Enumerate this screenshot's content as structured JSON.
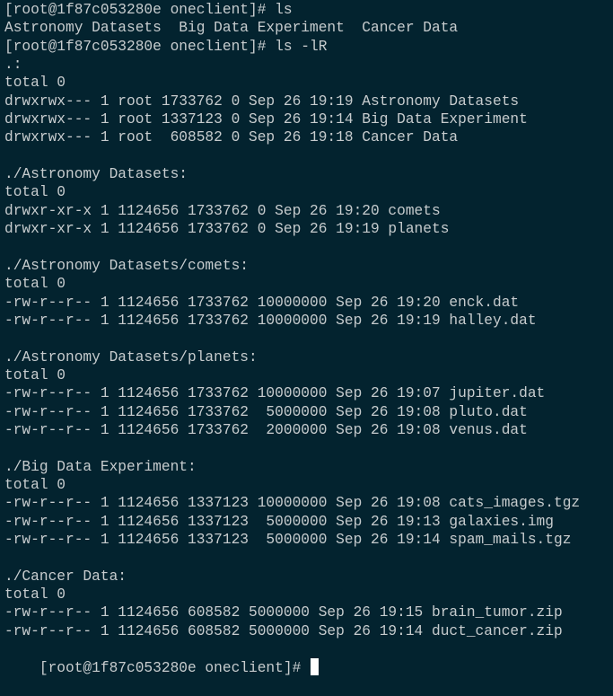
{
  "terminal": {
    "prompt": "[root@1f87c053280e oneclient]#",
    "lines": [
      "[root@1f87c053280e oneclient]# ls",
      "Astronomy Datasets  Big Data Experiment  Cancer Data",
      "[root@1f87c053280e oneclient]# ls -lR",
      ".:",
      "total 0",
      "drwxrwx--- 1 root 1733762 0 Sep 26 19:19 Astronomy Datasets",
      "drwxrwx--- 1 root 1337123 0 Sep 26 19:14 Big Data Experiment",
      "drwxrwx--- 1 root  608582 0 Sep 26 19:18 Cancer Data",
      "",
      "./Astronomy Datasets:",
      "total 0",
      "drwxr-xr-x 1 1124656 1733762 0 Sep 26 19:20 comets",
      "drwxr-xr-x 1 1124656 1733762 0 Sep 26 19:19 planets",
      "",
      "./Astronomy Datasets/comets:",
      "total 0",
      "-rw-r--r-- 1 1124656 1733762 10000000 Sep 26 19:20 enck.dat",
      "-rw-r--r-- 1 1124656 1733762 10000000 Sep 26 19:19 halley.dat",
      "",
      "./Astronomy Datasets/planets:",
      "total 0",
      "-rw-r--r-- 1 1124656 1733762 10000000 Sep 26 19:07 jupiter.dat",
      "-rw-r--r-- 1 1124656 1733762  5000000 Sep 26 19:08 pluto.dat",
      "-rw-r--r-- 1 1124656 1733762  2000000 Sep 26 19:08 venus.dat",
      "",
      "./Big Data Experiment:",
      "total 0",
      "-rw-r--r-- 1 1124656 1337123 10000000 Sep 26 19:08 cats_images.tgz",
      "-rw-r--r-- 1 1124656 1337123  5000000 Sep 26 19:13 galaxies.img",
      "-rw-r--r-- 1 1124656 1337123  5000000 Sep 26 19:14 spam_mails.tgz",
      "",
      "./Cancer Data:",
      "total 0",
      "-rw-r--r-- 1 1124656 608582 5000000 Sep 26 19:15 brain_tumor.zip",
      "-rw-r--r-- 1 1124656 608582 5000000 Sep 26 19:14 duct_cancer.zip"
    ],
    "current_input": ""
  },
  "colors": {
    "background": "#03232f",
    "foreground": "#c7ccce",
    "cursor": "#ffffff"
  }
}
